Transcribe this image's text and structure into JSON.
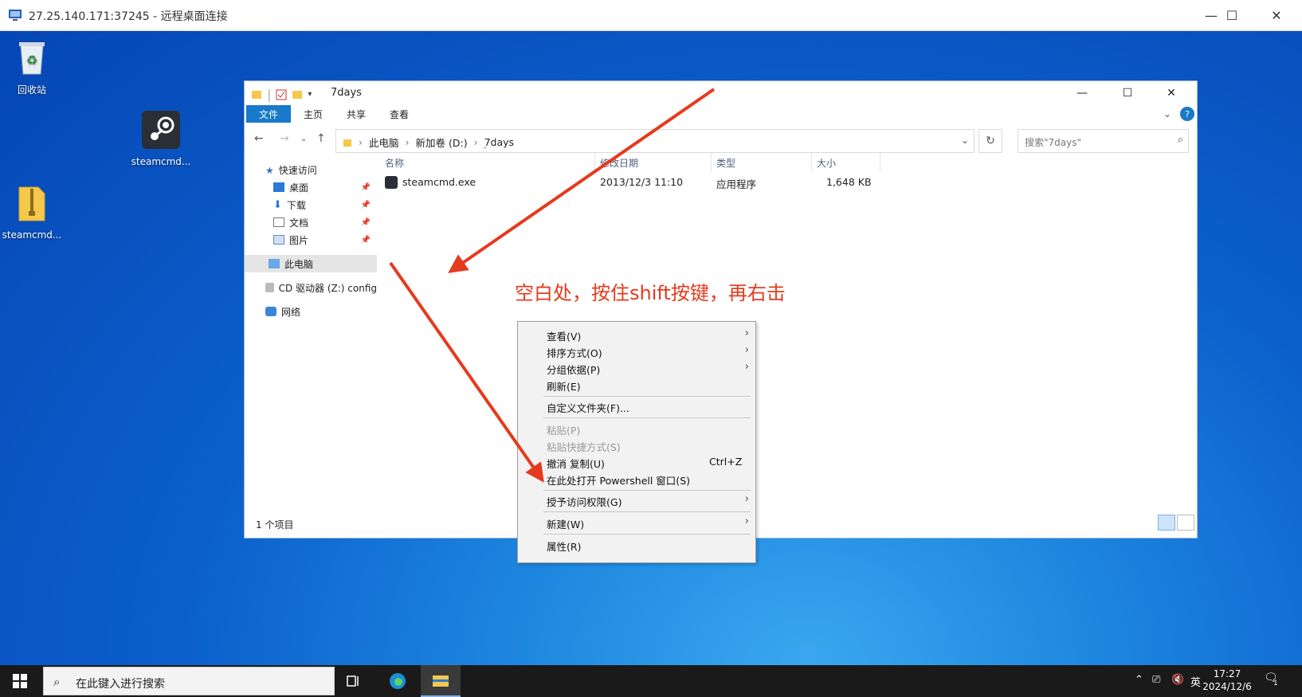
{
  "rdp_window": {
    "title": "27.25.140.171:37245 - 远程桌面连接",
    "controls": [
      "—",
      "☐",
      "✕"
    ]
  },
  "desktop": {
    "icons": [
      {
        "label": "回收站",
        "icon": "recycle-bin-icon"
      },
      {
        "label": "steamcmd...",
        "icon": "steam-icon"
      },
      {
        "label": "steamcmd...",
        "icon": "zip-folder-icon"
      }
    ]
  },
  "explorer": {
    "title": "7days",
    "controls": [
      "—",
      "☐",
      "✕"
    ],
    "ribbon_tabs": [
      "文件",
      "主页",
      "共享",
      "查看"
    ],
    "breadcrumb": [
      "此电脑",
      "新加卷 (D:)",
      "7days"
    ],
    "search_placeholder": "搜索\"7days\"",
    "nav": {
      "quick_access": "快速访问",
      "items": [
        {
          "label": "桌面",
          "pinned": true
        },
        {
          "label": "下载",
          "pinned": true
        },
        {
          "label": "文档",
          "pinned": true
        },
        {
          "label": "图片",
          "pinned": true
        }
      ],
      "this_pc": "此电脑",
      "cd_drive": "CD 驱动器 (Z:) config",
      "network": "网络"
    },
    "columns": [
      "名称",
      "修改日期",
      "类型",
      "大小"
    ],
    "files": [
      {
        "name": "steamcmd.exe",
        "modified": "2013/12/3 11:10",
        "type": "应用程序",
        "size": "1,648 KB"
      }
    ],
    "status": "1 个项目"
  },
  "context_menu": {
    "items": [
      {
        "label": "查看(V)",
        "submenu": true,
        "disabled": false
      },
      {
        "label": "排序方式(O)",
        "submenu": true,
        "disabled": false
      },
      {
        "label": "分组依据(P)",
        "submenu": true,
        "disabled": false
      },
      {
        "label": "刷新(E)",
        "submenu": false,
        "disabled": false
      },
      {
        "label": "自定义文件夹(F)...",
        "submenu": false,
        "disabled": false
      },
      {
        "label": "粘贴(P)",
        "submenu": false,
        "disabled": true
      },
      {
        "label": "粘贴快捷方式(S)",
        "submenu": false,
        "disabled": true
      },
      {
        "label": "撤消 复制(U)",
        "submenu": false,
        "disabled": false,
        "shortcut": "Ctrl+Z"
      },
      {
        "label": "在此处打开 Powershell 窗口(S)",
        "submenu": false,
        "disabled": false
      },
      {
        "label": "授予访问权限(G)",
        "submenu": true,
        "disabled": false
      },
      {
        "label": "新建(W)",
        "submenu": true,
        "disabled": false
      },
      {
        "label": "属性(R)",
        "submenu": false,
        "disabled": false
      }
    ]
  },
  "annotation": {
    "text": "空白处，按住shift按键，再右击",
    "color": "#e53a1d"
  },
  "taskbar": {
    "search_placeholder": "在此键入进行搜索",
    "apps": [
      "task-view-icon",
      "edge-icon",
      "file-explorer-icon"
    ],
    "tray": {
      "ime": "英"
    },
    "time": "17:27",
    "date": "2024/12/6",
    "notifications": "1"
  },
  "colors": {
    "accent": "#1979ca",
    "desktop": "#0b5fcc",
    "annotation": "#e53a1d"
  }
}
